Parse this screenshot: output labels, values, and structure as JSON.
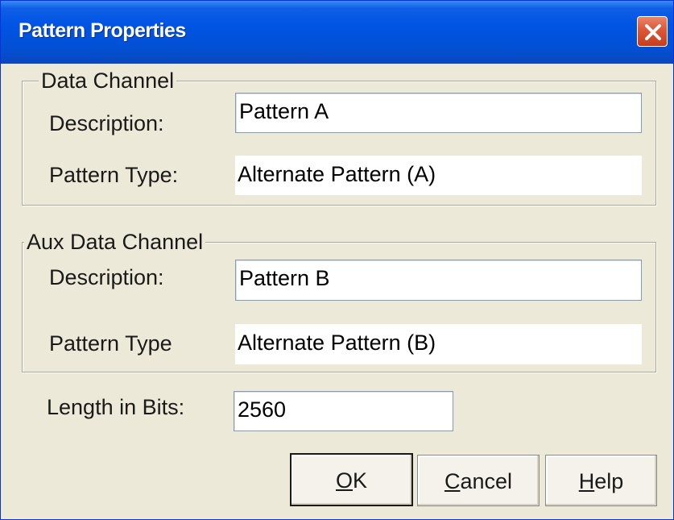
{
  "window": {
    "title": "Pattern Properties",
    "close_icon": "close-icon"
  },
  "data_channel": {
    "group_label": "Data Channel",
    "description_label": "Description:",
    "description_value": "Pattern A",
    "pattern_type_label": "Pattern Type:",
    "pattern_type_value": "Alternate Pattern (A)"
  },
  "aux_data_channel": {
    "group_label": "Aux Data Channel",
    "description_label": "Description:",
    "description_value": "Pattern B",
    "pattern_type_label": "Pattern Type",
    "pattern_type_value": "Alternate Pattern (B)"
  },
  "length": {
    "label": "Length in Bits:",
    "value": "2560"
  },
  "buttons": {
    "ok": {
      "accel": "O",
      "rest": "K"
    },
    "cancel": {
      "accel": "C",
      "rest": "ancel"
    },
    "help": {
      "accel": "H",
      "rest": "elp"
    }
  },
  "colors": {
    "titlebar": "#0054e3",
    "dialog_bg": "#ece9d8",
    "close_button": "#de5a3a",
    "group_border": "#aca899",
    "edit_border": "#7f9db9"
  }
}
